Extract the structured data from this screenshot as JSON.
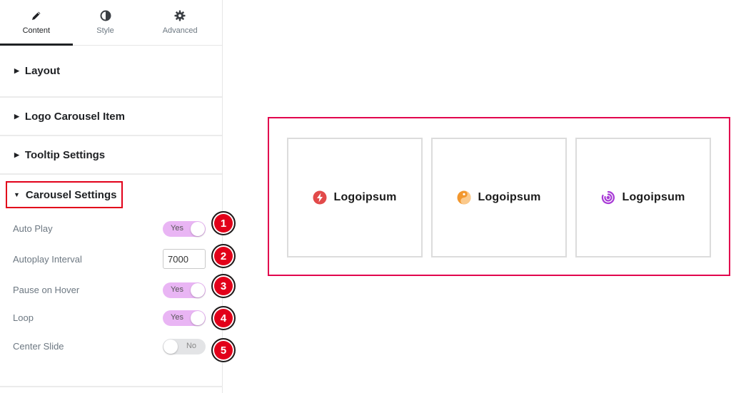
{
  "tabs": [
    {
      "label": "Content",
      "icon": "pencil-icon",
      "active": true
    },
    {
      "label": "Style",
      "icon": "half-circle-icon",
      "active": false
    },
    {
      "label": "Advanced",
      "icon": "gear-icon",
      "active": false
    }
  ],
  "sections": [
    {
      "label": "Layout"
    },
    {
      "label": "Logo Carousel Item"
    },
    {
      "label": "Tooltip Settings"
    }
  ],
  "open_section": {
    "label": "Carousel Settings",
    "controls": [
      {
        "label": "Auto Play",
        "type": "switch",
        "state": "on",
        "value_label": "Yes",
        "badge": "1"
      },
      {
        "label": "Autoplay Interval",
        "type": "number",
        "value": "7000",
        "badge": "2"
      },
      {
        "label": "Pause on Hover",
        "type": "switch",
        "state": "on",
        "value_label": "Yes",
        "badge": "3"
      },
      {
        "label": "Loop",
        "type": "switch",
        "state": "on",
        "value_label": "Yes",
        "badge": "4"
      },
      {
        "label": "Center Slide",
        "type": "switch",
        "state": "off",
        "value_label": "No",
        "badge": "5"
      }
    ]
  },
  "carousel": {
    "items": [
      {
        "text": "Logoipsum",
        "icon": "bolt-circle-logo-icon",
        "color": "#e24a4a"
      },
      {
        "text": "Logoipsum",
        "icon": "yin-yang-logo-icon",
        "color": "#f2972e"
      },
      {
        "text": "Logoipsum",
        "icon": "spiral-logo-icon",
        "color": "#a83bd6"
      }
    ]
  },
  "colors": {
    "highlight": "#e2001a",
    "switch_on": "#e9b5f4",
    "switch_off": "#e3e4e6"
  }
}
